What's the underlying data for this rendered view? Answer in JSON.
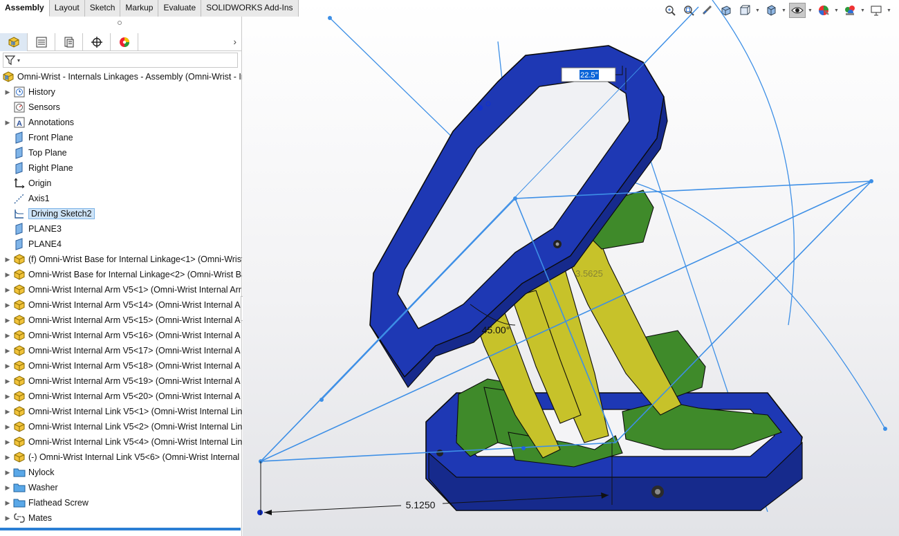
{
  "command_tabs": [
    "Assembly",
    "Layout",
    "Sketch",
    "Markup",
    "Evaluate",
    "SOLIDWORKS Add-Ins"
  ],
  "active_tab": "Assembly",
  "panel_tabs": [
    "feature-manager-icon",
    "property-manager-icon",
    "configuration-manager-icon",
    "dimxpert-icon",
    "display-manager-icon"
  ],
  "filter_icon": "funnel-icon",
  "tree": {
    "root": "Omni-Wrist - Internals Linkages - Assembly (Omni-Wrist - Int",
    "items": [
      {
        "label": "History",
        "icon": "history-icon",
        "expandable": true
      },
      {
        "label": "Sensors",
        "icon": "sensors-icon",
        "expandable": false
      },
      {
        "label": "Annotations",
        "icon": "annotations-icon",
        "expandable": true
      },
      {
        "label": "Front Plane",
        "icon": "plane-icon",
        "expandable": false
      },
      {
        "label": "Top Plane",
        "icon": "plane-icon",
        "expandable": false
      },
      {
        "label": "Right Plane",
        "icon": "plane-icon",
        "expandable": false
      },
      {
        "label": "Origin",
        "icon": "origin-icon",
        "expandable": false
      },
      {
        "label": "Axis1",
        "icon": "axis-icon",
        "expandable": false
      },
      {
        "label": "Driving Sketch2",
        "icon": "sketch-icon",
        "expandable": false,
        "selected": true
      },
      {
        "label": "PLANE3",
        "icon": "plane-icon",
        "expandable": false
      },
      {
        "label": "PLANE4",
        "icon": "plane-icon",
        "expandable": false
      },
      {
        "label": "(f) Omni-Wrist Base for Internal Linkage<1> (Omni-Wrist",
        "icon": "part-icon",
        "expandable": true
      },
      {
        "label": "Omni-Wrist Base for Internal Linkage<2> (Omni-Wrist Ba",
        "icon": "part-icon",
        "expandable": true
      },
      {
        "label": "Omni-Wrist Internal Arm V5<1> (Omni-Wrist Internal Arr",
        "icon": "part-icon",
        "expandable": true
      },
      {
        "label": "Omni-Wrist Internal Arm V5<14> (Omni-Wrist Internal A",
        "icon": "part-icon",
        "expandable": true
      },
      {
        "label": "Omni-Wrist Internal Arm V5<15> (Omni-Wrist Internal A",
        "icon": "part-icon",
        "expandable": true
      },
      {
        "label": "Omni-Wrist Internal Arm V5<16> (Omni-Wrist Internal A",
        "icon": "part-icon",
        "expandable": true
      },
      {
        "label": "Omni-Wrist Internal Arm V5<17> (Omni-Wrist Internal A",
        "icon": "part-icon",
        "expandable": true
      },
      {
        "label": "Omni-Wrist Internal Arm V5<18> (Omni-Wrist Internal A",
        "icon": "part-icon",
        "expandable": true
      },
      {
        "label": "Omni-Wrist Internal Arm V5<19> (Omni-Wrist Internal A",
        "icon": "part-icon",
        "expandable": true
      },
      {
        "label": "Omni-Wrist Internal Arm V5<20> (Omni-Wrist Internal A",
        "icon": "part-icon",
        "expandable": true
      },
      {
        "label": "Omni-Wrist Internal Link V5<1> (Omni-Wrist Internal Lin",
        "icon": "part-icon",
        "expandable": true
      },
      {
        "label": "Omni-Wrist Internal Link V5<2> (Omni-Wrist Internal Lin",
        "icon": "part-icon",
        "expandable": true
      },
      {
        "label": "Omni-Wrist Internal Link V5<4> (Omni-Wrist Internal Lin",
        "icon": "part-icon",
        "expandable": true
      },
      {
        "label": "(-) Omni-Wrist Internal Link V5<6> (Omni-Wrist Internal",
        "icon": "part-icon",
        "expandable": true
      },
      {
        "label": "Nylock",
        "icon": "folder-icon",
        "expandable": true
      },
      {
        "label": "Washer",
        "icon": "folder-icon",
        "expandable": true
      },
      {
        "label": "Flathead Screw",
        "icon": "folder-icon",
        "expandable": true
      },
      {
        "label": "Mates",
        "icon": "mates-icon",
        "expandable": true
      }
    ]
  },
  "viewport": {
    "dim_angle_top": "22.5°",
    "dim_angle_mid": "45.00°",
    "dim_length": "5.1250",
    "dim_ghost": "3.5625",
    "hud_icons": [
      "zoom-to-fit-icon",
      "zoom-to-area-icon",
      "previous-view-icon",
      "section-view-icon",
      "view-orientation-icon",
      "display-style-icon",
      "hide-show-items-icon",
      "edit-appearance-icon",
      "apply-scene-icon",
      "view-settings-icon"
    ],
    "colors": {
      "sketch": "#3d8fe6",
      "base_ring": "#1e38b4",
      "link": "#3f8a2a",
      "arm": "#c7c22a",
      "edge": "#0b0b0b"
    }
  }
}
